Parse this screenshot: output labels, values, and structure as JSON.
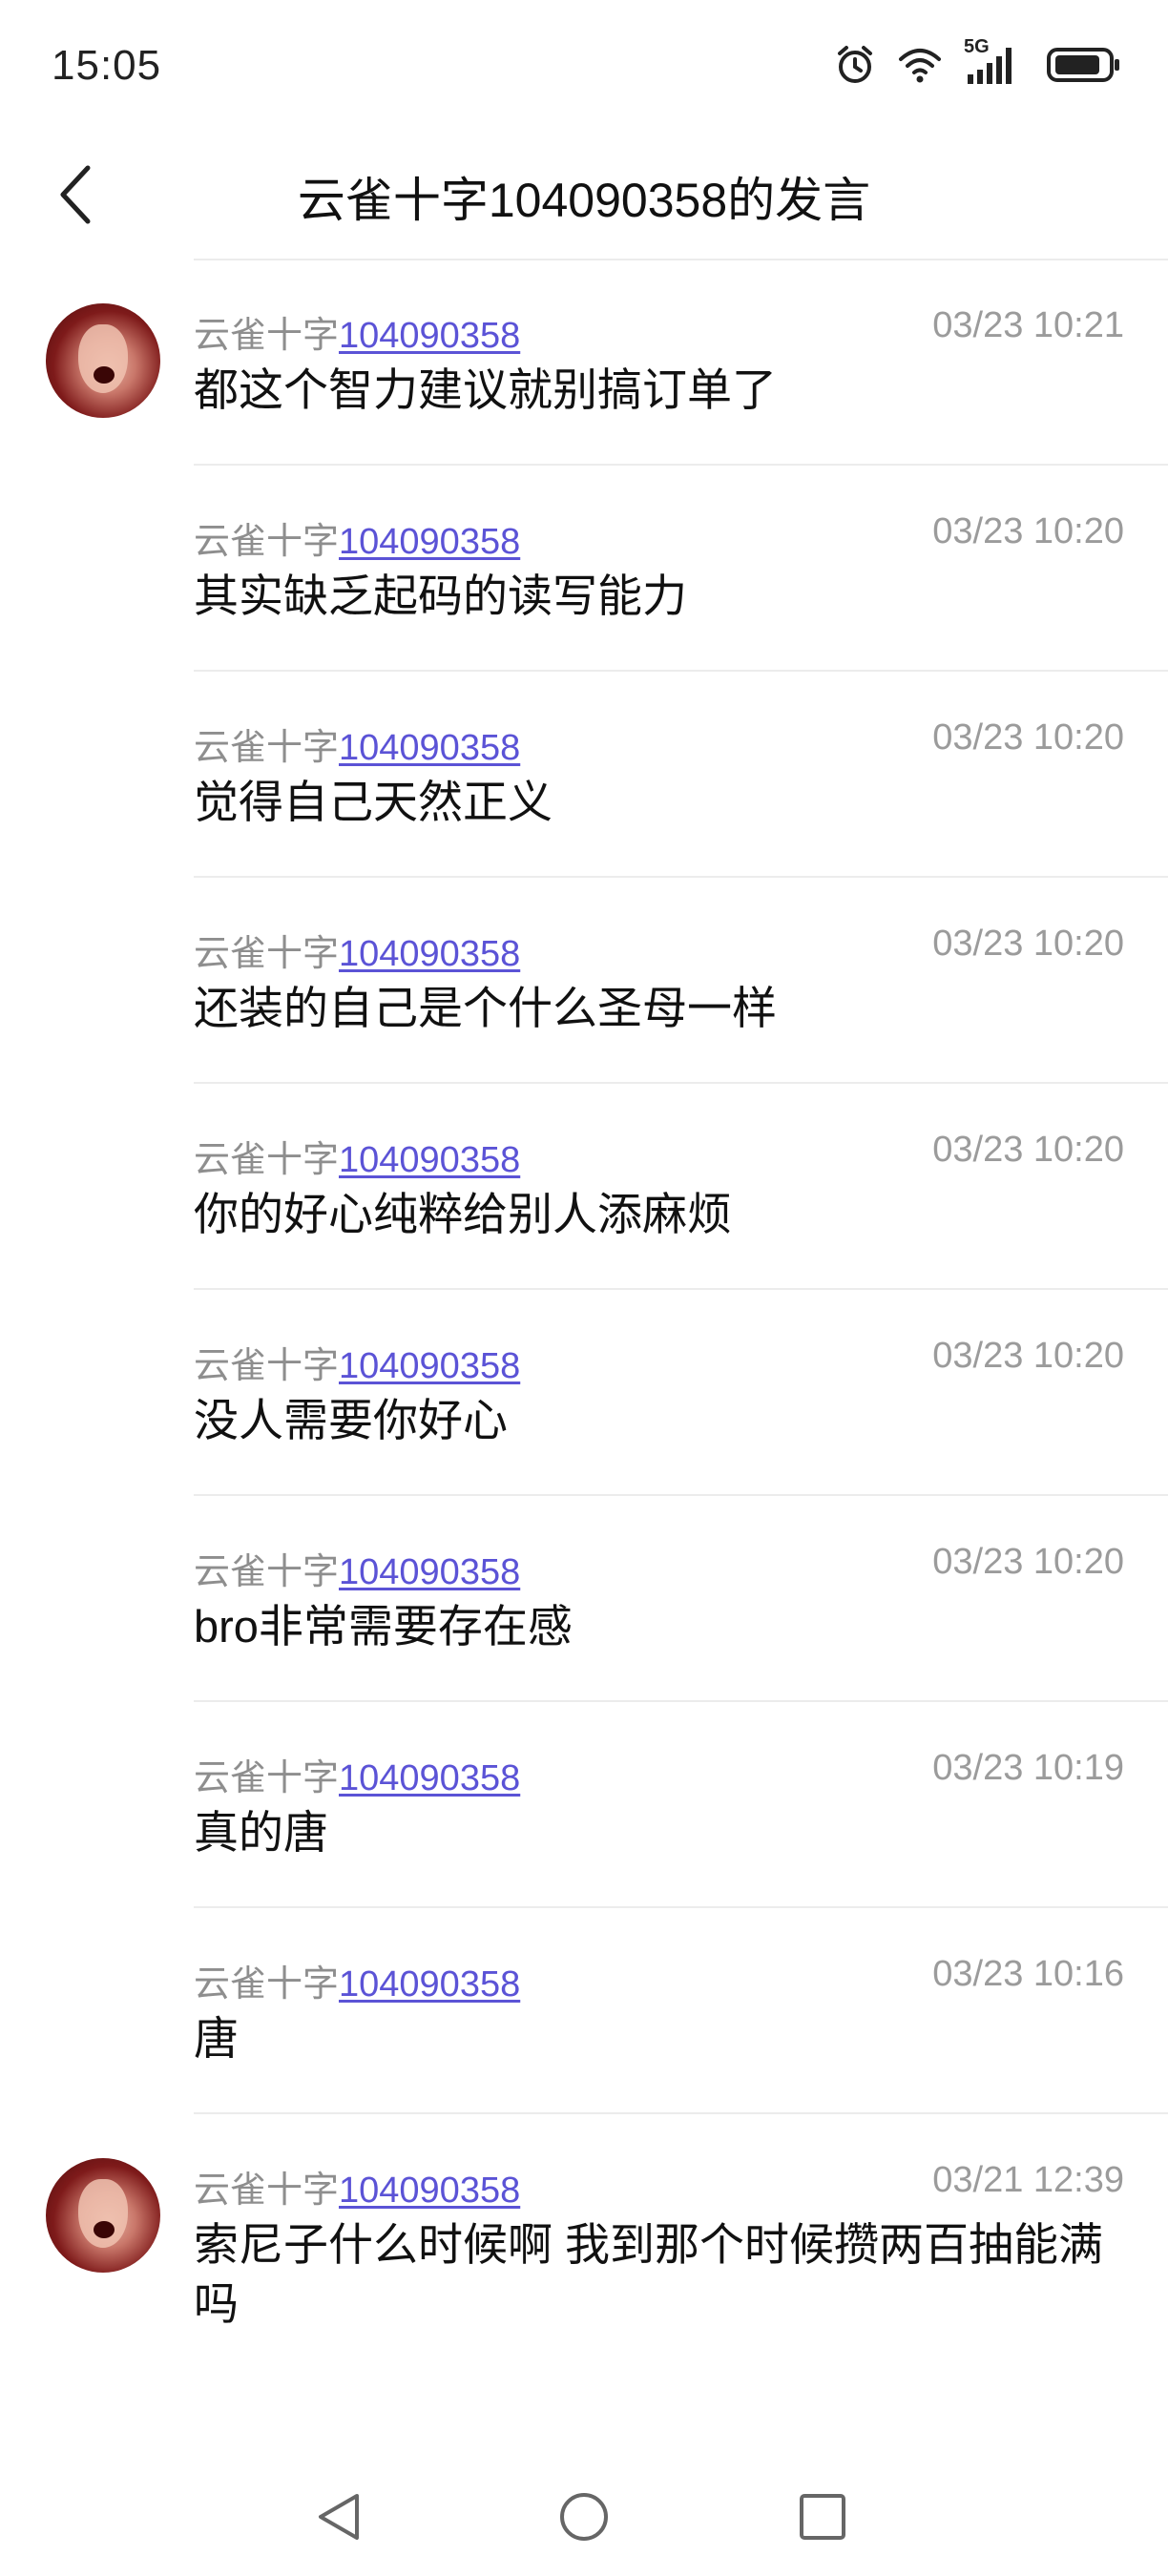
{
  "status_bar": {
    "time": "15:05",
    "network_label": "5G",
    "icons": [
      "alarm-icon",
      "wifi-icon",
      "signal-icon",
      "battery-icon"
    ]
  },
  "header": {
    "title": "云雀十字104090358的发言",
    "back_icon": "chevron-left-icon"
  },
  "messages": [
    {
      "name_prefix": "云雀十字",
      "uid": "104090358",
      "time": "03/23 10:21",
      "text": "都这个智力建议就别搞订单了",
      "show_avatar": true
    },
    {
      "name_prefix": "云雀十字",
      "uid": "104090358",
      "time": "03/23 10:20",
      "text": "其实缺乏起码的读写能力",
      "show_avatar": false
    },
    {
      "name_prefix": "云雀十字",
      "uid": "104090358",
      "time": "03/23 10:20",
      "text": "觉得自己天然正义",
      "show_avatar": false
    },
    {
      "name_prefix": "云雀十字",
      "uid": "104090358",
      "time": "03/23 10:20",
      "text": "还装的自己是个什么圣母一样",
      "show_avatar": false
    },
    {
      "name_prefix": "云雀十字",
      "uid": "104090358",
      "time": "03/23 10:20",
      "text": "你的好心纯粹给别人添麻烦",
      "show_avatar": false
    },
    {
      "name_prefix": "云雀十字",
      "uid": "104090358",
      "time": "03/23 10:20",
      "text": "没人需要你好心",
      "show_avatar": false
    },
    {
      "name_prefix": "云雀十字",
      "uid": "104090358",
      "time": "03/23 10:20",
      "text": "bro非常需要存在感",
      "show_avatar": false
    },
    {
      "name_prefix": "云雀十字",
      "uid": "104090358",
      "time": "03/23 10:19",
      "text": "真的唐",
      "show_avatar": false
    },
    {
      "name_prefix": "云雀十字",
      "uid": "104090358",
      "time": "03/23 10:16",
      "text": "唐",
      "show_avatar": false
    },
    {
      "name_prefix": "云雀十字",
      "uid": "104090358",
      "time": "03/21 12:39",
      "text": "索尼子什么时候啊 我到那个时候攒两百抽能满吗",
      "show_avatar": true
    }
  ],
  "nav_bar": {
    "icons": [
      "back-triangle-icon",
      "home-circle-icon",
      "recents-square-icon"
    ]
  },
  "colors": {
    "uid_link": "#5b53d6",
    "meta_text": "#8e8e8e",
    "divider": "#ececec"
  }
}
